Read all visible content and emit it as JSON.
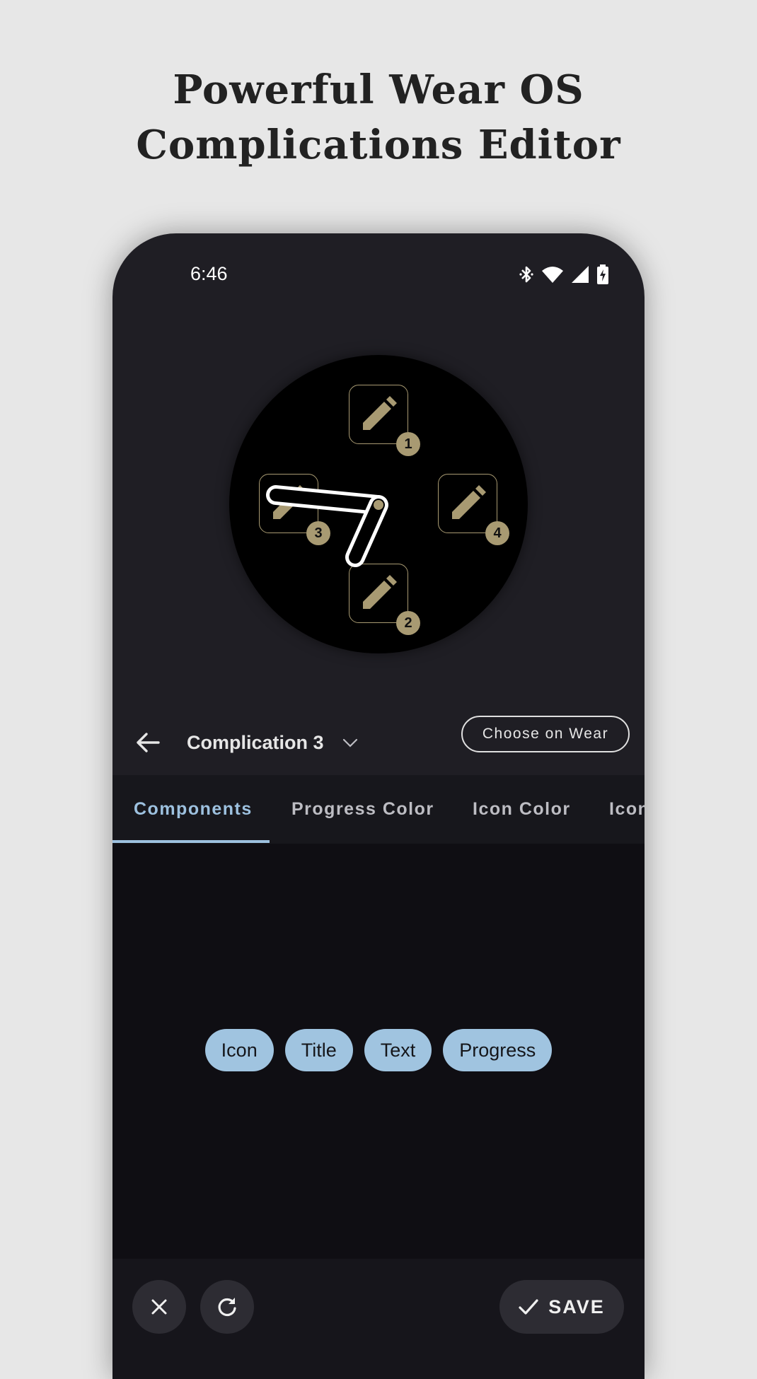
{
  "headline": {
    "line1": "Powerful Wear OS",
    "line2": "Complications Editor"
  },
  "status_bar": {
    "time": "6:46",
    "icons": [
      "bluetooth-icon",
      "wifi-icon",
      "signal-icon",
      "battery-charging-icon"
    ]
  },
  "watch_face": {
    "accent_color": "#a89a72",
    "slots": [
      {
        "number": "1",
        "icon": "pencil-icon"
      },
      {
        "number": "2",
        "icon": "pencil-icon"
      },
      {
        "number": "3",
        "icon": "pencil-icon"
      },
      {
        "number": "4",
        "icon": "pencil-icon"
      }
    ]
  },
  "toolbar": {
    "back_icon": "arrow-back-icon",
    "selected_complication": "Complication 3",
    "dropdown_icon": "chevron-down-icon",
    "choose_button": "Choose on Wear"
  },
  "tabs": [
    {
      "label": "Components",
      "active": true
    },
    {
      "label": "Progress Color",
      "active": false
    },
    {
      "label": "Icon Color",
      "active": false
    },
    {
      "label": "Icon",
      "active": false
    }
  ],
  "chips": [
    "Icon",
    "Title",
    "Text",
    "Progress"
  ],
  "bottom_bar": {
    "close_icon": "close-icon",
    "reset_icon": "refresh-icon",
    "save_icon": "check-icon",
    "save_label": "SAVE"
  },
  "colors": {
    "tab_active": "#9dc1df",
    "chip_bg": "#a0c4e0"
  }
}
